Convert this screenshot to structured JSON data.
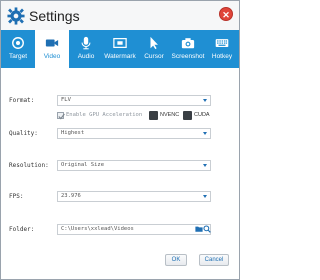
{
  "window": {
    "title": "Settings"
  },
  "tabs": [
    {
      "label": "Target",
      "icon": "target-icon",
      "active": false
    },
    {
      "label": "Video",
      "icon": "video-camera-icon",
      "active": true
    },
    {
      "label": "Audio",
      "icon": "microphone-icon",
      "active": false
    },
    {
      "label": "Watermark",
      "icon": "watermark-icon",
      "active": false
    },
    {
      "label": "Cursor",
      "icon": "cursor-icon",
      "active": false
    },
    {
      "label": "Screenshot",
      "icon": "camera-icon",
      "active": false
    },
    {
      "label": "Hotkey",
      "icon": "keyboard-icon",
      "active": false
    }
  ],
  "form": {
    "format_label": "Format:",
    "format_value": "FLV",
    "gpu_label": "Enable GPU Acceleration",
    "gpu_checked": true,
    "nvenc_label": "NVENC",
    "cuda_label": "CUDA",
    "quality_label": "Quality:",
    "quality_value": "Highest",
    "resolution_label": "Resolution:",
    "resolution_value": "Original Size",
    "fps_label": "FPS:",
    "fps_value": "23.976",
    "folder_label": "Folder:",
    "folder_value": "C:\\Users\\xxlead\\Videos"
  },
  "buttons": {
    "ok": "OK",
    "cancel": "Cancel"
  },
  "colors": {
    "accent": "#1f8fd3",
    "close": "#e0453a"
  }
}
